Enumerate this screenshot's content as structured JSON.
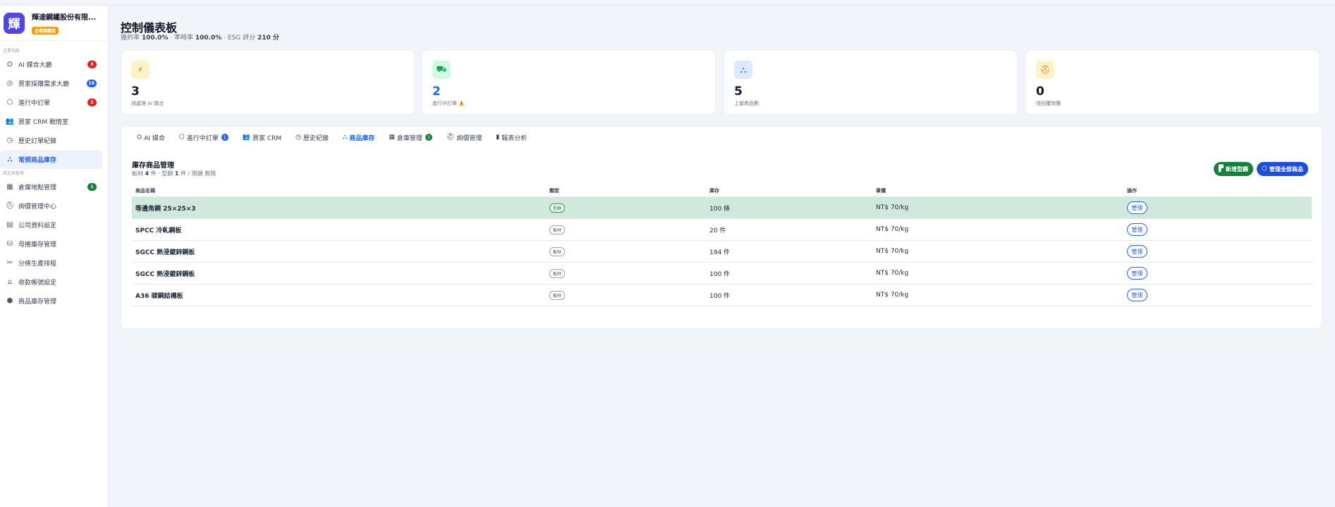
{
  "brand": {
    "logo": "輝",
    "name": "輝達鋼鐵股份有限...",
    "tag": "企業旗艦版"
  },
  "sidebar": {
    "sections": [
      {
        "title": "企業功能",
        "items": [
          {
            "label": "AI 媒合大廳",
            "icon": "robot-icon",
            "badge": "3",
            "badge_color": "#dc2626"
          },
          {
            "label": "買家採購需求大廳",
            "icon": "target-icon",
            "badge": "16",
            "badge_color": "#2563eb"
          },
          {
            "label": "進行中訂單",
            "icon": "box-icon",
            "badge": "2",
            "badge_color": "#dc2626"
          },
          {
            "label": "買家 CRM 戰情室",
            "icon": "users-icon",
            "badge": "",
            "badge_color": ""
          },
          {
            "label": "歷史訂單紀錄",
            "icon": "clock-icon",
            "badge": "",
            "badge_color": ""
          },
          {
            "label": "常規商品庫存",
            "icon": "stack-icon",
            "badge": "",
            "badge_color": "",
            "active": true
          }
        ]
      },
      {
        "title": "設定與管理",
        "items": [
          {
            "label": "倉庫地點管理",
            "icon": "warehouse-icon",
            "badge": "1",
            "badge_color": "#15803d"
          },
          {
            "label": "詢價管理中心",
            "icon": "hardhat-icon",
            "badge": "",
            "badge_color": ""
          },
          {
            "label": "公司資料設定",
            "icon": "building-icon",
            "badge": "",
            "badge_color": ""
          },
          {
            "label": "母捲庫存管理",
            "icon": "cylinder-icon",
            "badge": "",
            "badge_color": ""
          },
          {
            "label": "分條生產排程",
            "icon": "scissors-icon",
            "badge": "",
            "badge_color": ""
          },
          {
            "label": "收款帳號設定",
            "icon": "bank-icon",
            "badge": "",
            "badge_color": ""
          },
          {
            "label": "商品庫存管理",
            "icon": "cube-icon",
            "badge": "",
            "badge_color": ""
          }
        ]
      }
    ]
  },
  "header": {
    "title": "控制儀表板",
    "sub_prefix1": "履約率 ",
    "fulfill": "100.0%",
    "sub_prefix2": " · 準時率 ",
    "ontime": "100.0%",
    "sub_prefix3": " · ESG 評分 ",
    "esg": "210 分"
  },
  "stats": [
    {
      "value": "3",
      "label": "待處理 AI 媒合",
      "icon": "bolt-icon",
      "glyph": "⚡",
      "bg": "#fef3c7",
      "color": "#d97706",
      "value_color": "#111827"
    },
    {
      "value": "2",
      "label": "進行中訂單 ⚠️",
      "icon": "truck-icon",
      "glyph": "⛟",
      "bg": "#d1fae5",
      "color": "#16a34a",
      "value_color": "#2563eb"
    },
    {
      "value": "5",
      "label": "上架商品數",
      "icon": "stack-icon",
      "glyph": "⛬",
      "bg": "#dbeafe",
      "color": "#2563eb",
      "value_color": "#111827"
    },
    {
      "value": "0",
      "label": "待回覆詢價",
      "icon": "hardhat-icon",
      "glyph": "⛑",
      "bg": "#fef3c7",
      "color": "#d97706",
      "value_color": "#111827"
    }
  ],
  "tabs": [
    {
      "label": "AI 媒合",
      "icon": "robot-icon",
      "glyph": "⛭",
      "badge": ""
    },
    {
      "label": "進行中訂單",
      "icon": "box-icon",
      "glyph": "⬡",
      "badge": "1",
      "badge_color": "#2563eb"
    },
    {
      "label": "買家 CRM",
      "icon": "users-icon",
      "glyph": "👥",
      "badge": ""
    },
    {
      "label": "歷史紀錄",
      "icon": "clock-icon",
      "glyph": "◷",
      "badge": ""
    },
    {
      "label": "商品庫存",
      "icon": "stack-icon",
      "glyph": "⛬",
      "badge": "",
      "active": true
    },
    {
      "label": "倉庫管理",
      "icon": "warehouse-icon",
      "glyph": "▦",
      "badge": "1",
      "badge_color": "#15803d"
    },
    {
      "label": "詢價管理",
      "icon": "hardhat-icon",
      "glyph": "⛑",
      "badge": ""
    },
    {
      "label": "報表分析",
      "icon": "chart-icon",
      "glyph": "▮",
      "badge": ""
    }
  ],
  "inventory": {
    "title": "庫存商品管理",
    "sub_prefix1": "板材 ",
    "plate_count": "4",
    "sub_mid1": " 件 · 型鋼 ",
    "section_count": "1",
    "sub_mid2": " 件 / 限額 無限",
    "btn_add": "新增型鋼",
    "btn_manage_all": "管理全部商品",
    "columns": [
      "商品名稱",
      "類型",
      "庫存",
      "單價",
      "操作"
    ],
    "rows": [
      {
        "name": "等邊角鋼 25×25×3",
        "type": "型鋼",
        "stock": "100 條",
        "price": "NT$ 70/kg",
        "action": "管理",
        "highlight": true
      },
      {
        "name": "SPCC 冷軋鋼板",
        "type": "板材",
        "stock": "20 件",
        "price": "NT$ 70/kg",
        "action": "管理"
      },
      {
        "name": "SGCC 熱浸鍍鋅鋼板",
        "type": "板材",
        "stock": "194 件",
        "price": "NT$ 70/kg",
        "action": "管理"
      },
      {
        "name": "SGCC 熱浸鍍鋅鋼板",
        "type": "板材",
        "stock": "100 件",
        "price": "NT$ 70/kg",
        "action": "管理"
      },
      {
        "name": "A36 碳鋼結構板",
        "type": "板材",
        "stock": "100 件",
        "price": "NT$ 70/kg",
        "action": "管理"
      }
    ]
  }
}
